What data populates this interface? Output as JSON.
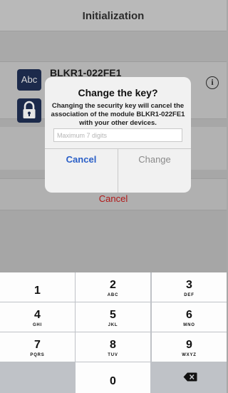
{
  "nav": {
    "title": "Initialization"
  },
  "device": {
    "badge_text": "Abc",
    "name": "BLKR1-022FE1",
    "info_icon": "info-icon",
    "lock_icon": "lock-icon"
  },
  "background": {
    "cancel_label": "Cancel"
  },
  "alert": {
    "title": "Change the key?",
    "message": "Changing the security key will cancel the association of the module BLKR1-022FE1 with your other devices.",
    "input_placeholder": "Maximum 7 digits",
    "input_value": "",
    "cancel_label": "Cancel",
    "change_label": "Change"
  },
  "keypad": {
    "keys": [
      {
        "digit": "1",
        "letters": ""
      },
      {
        "digit": "2",
        "letters": "ABC"
      },
      {
        "digit": "3",
        "letters": "DEF"
      },
      {
        "digit": "4",
        "letters": "GHI"
      },
      {
        "digit": "5",
        "letters": "JKL"
      },
      {
        "digit": "6",
        "letters": "MNO"
      },
      {
        "digit": "7",
        "letters": "PQRS"
      },
      {
        "digit": "8",
        "letters": "TUV"
      },
      {
        "digit": "9",
        "letters": "WXYZ"
      },
      {
        "digit": "0",
        "letters": ""
      }
    ],
    "backspace_icon": "backspace-icon"
  },
  "colors": {
    "accent": "#2a5fc7",
    "destructive": "#b01818",
    "badge": "#1c2a4b"
  }
}
